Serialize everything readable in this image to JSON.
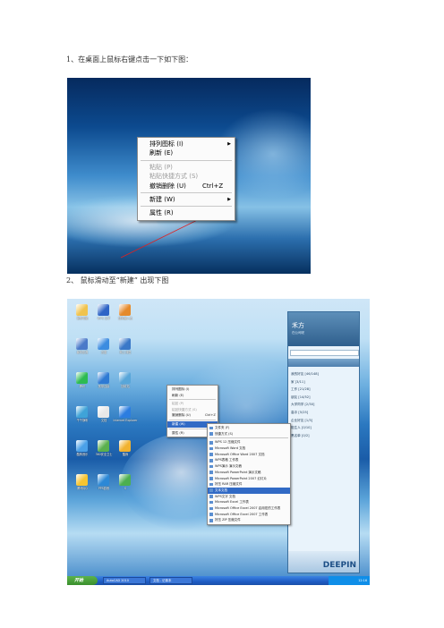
{
  "step1": {
    "label": "1、在桌面上鼠标右键点击一下如下图："
  },
  "step2": {
    "label": "2、 鼠标滑动至“新建” 出现下图"
  },
  "menu1": {
    "items": [
      {
        "label": "排列图标 (I)",
        "submenu": true,
        "disabled": false
      },
      {
        "label": "刷新 (E)",
        "submenu": false,
        "disabled": false
      },
      {
        "sep": true
      },
      {
        "label": "粘贴 (P)",
        "submenu": false,
        "disabled": true
      },
      {
        "label": "粘贴快捷方式 (S)",
        "submenu": false,
        "disabled": true
      },
      {
        "label": "撤销删除 (U)",
        "shortcut": "Ctrl+Z",
        "submenu": false,
        "disabled": false
      },
      {
        "sep": true
      },
      {
        "label": "新建 (W)",
        "submenu": true,
        "disabled": false
      },
      {
        "sep": true
      },
      {
        "label": "属性 (R)",
        "submenu": false,
        "disabled": false
      }
    ]
  },
  "desktop_icons": [
    {
      "label": "我的电脑",
      "color": "#f0c34d"
    },
    {
      "label": "WPS 文字",
      "color": "#2f64c6"
    },
    {
      "label": "搜狗输入法",
      "color": "#e58a2c"
    },
    {
      "label": "暴风影音",
      "color": "#4a79c9"
    },
    {
      "label": "迅雷",
      "color": "#3c8ce0"
    },
    {
      "label": "网上邻居",
      "color": "#3a78c8"
    },
    {
      "label": "腾讯",
      "color": "#2dbb52"
    },
    {
      "label": "宽带连接",
      "color": "#2e7ad4"
    },
    {
      "label": "回收站",
      "color": "#58a6d9"
    },
    {
      "label": "千千静听",
      "color": "#3fa3d8"
    },
    {
      "label": "文档",
      "color": "#e8e8e8"
    },
    {
      "label": "Internet Explorer",
      "color": "#2c7de0"
    },
    {
      "label": "酷狗音乐",
      "color": "#4aa0e8"
    },
    {
      "label": "360安全卫士",
      "color": "#5ab04d"
    },
    {
      "label": "酷我",
      "color": "#f1b22f"
    },
    {
      "label": "腾讯QQ",
      "color": "#f7c531"
    },
    {
      "label": "PPS影音",
      "color": "#2c88d6"
    },
    {
      "label": "S",
      "color": "#4caf50"
    }
  ],
  "qq": {
    "name": "禾方",
    "sign": "在公司呢",
    "groups": [
      "我的好友 [46/148]",
      "家 [3/11]",
      "工作 [21/28]",
      "朋友 [14/52]",
      "大学同学 [2/30]",
      "高中 [5/25]",
      "企业好友 [1/3]",
      "陌生人 [0/10]",
      "黑名单 [0/2]"
    ],
    "brand": "DEEPIN"
  },
  "menu2": {
    "items": [
      {
        "label": "排列图标 (I)"
      },
      {
        "label": "刷新 (E)"
      },
      {
        "sep": true
      },
      {
        "label": "粘贴 (P)",
        "disabled": true
      },
      {
        "label": "粘贴快捷方式 (S)",
        "disabled": true
      },
      {
        "label": "撤销删除 (U)",
        "shortcut": "Ctrl+Z"
      },
      {
        "sep": true
      },
      {
        "label": "新建 (W)",
        "highlight": true
      },
      {
        "sep": true
      },
      {
        "label": "属性 (R)"
      }
    ]
  },
  "menu3": {
    "items": [
      {
        "label": "文件夹 (F)"
      },
      {
        "label": "快捷方式 (S)"
      },
      {
        "sep": true
      },
      {
        "label": "WPS 12 压缩文件"
      },
      {
        "label": "Microsoft Word 文档"
      },
      {
        "label": "Microsoft Office Word 2007 文档"
      },
      {
        "label": "WPS表格 工作表"
      },
      {
        "label": "WPS演示 演示文稿"
      },
      {
        "label": "Microsoft PowerPoint 演示文稿"
      },
      {
        "label": "Microsoft PowerPoint 2007 幻灯片"
      },
      {
        "label": "好压 RAR 压缩文件"
      },
      {
        "label": "文本文档",
        "highlight": true
      },
      {
        "label": "WPS文字 文档"
      },
      {
        "label": "Microsoft Excel 工作表"
      },
      {
        "label": "Microsoft Office Excel 2007 启用宏的工作表"
      },
      {
        "label": "Microsoft Office Excel 2007 工作表"
      },
      {
        "label": "好压 ZIP 压缩文件"
      }
    ]
  },
  "taskbar": {
    "start": "开始",
    "tasks": [
      "AutoCAD 2010",
      "文档 - 记事本"
    ],
    "clock": "12:16"
  }
}
